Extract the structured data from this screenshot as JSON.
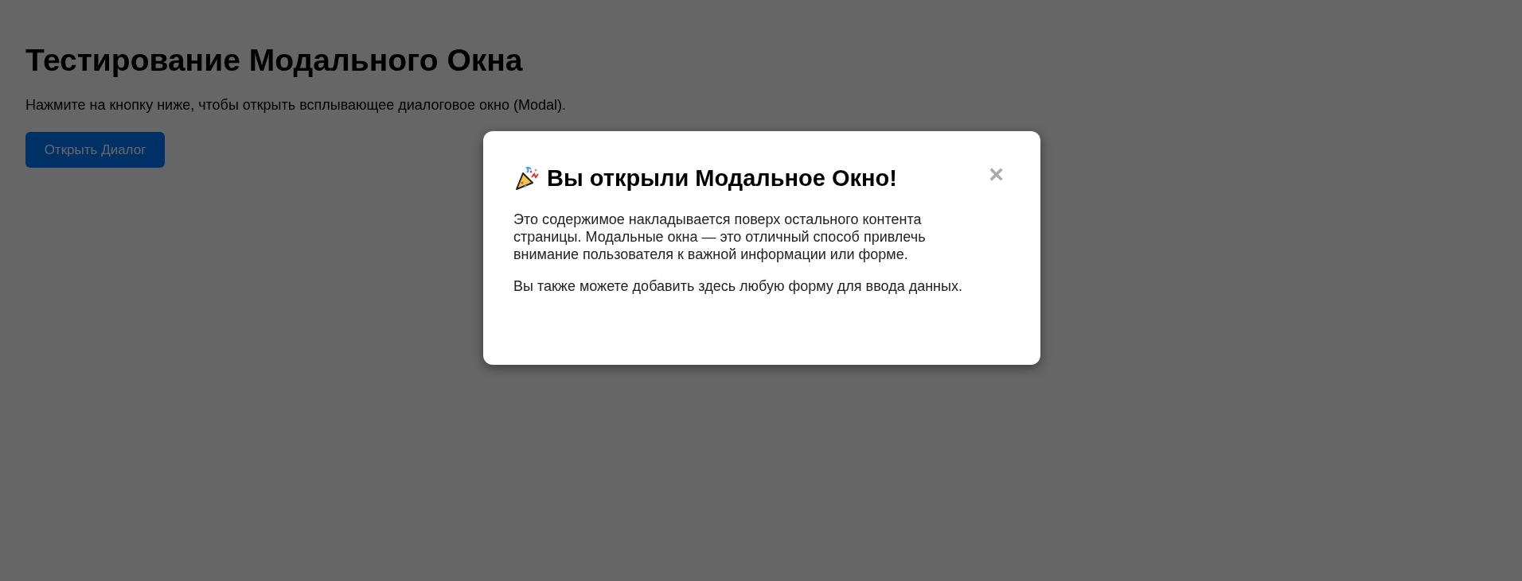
{
  "page": {
    "title": "Тестирование Модального Окна",
    "description": "Нажмите на кнопку ниже, чтобы открыть всплывающее диалоговое окно (Modal).",
    "button": "Открыть Диалог"
  },
  "modal": {
    "open": true,
    "title": "Вы открыли Модальное Окно!",
    "close": "×",
    "paragraphs": [
      "Это содержимое накладывается поверх остального контента страницы. Модальные окна — это отличный способ привлечь внимание пользователя к важной информации или форме.",
      "Вы также можете добавить здесь любую форму для ввода данных."
    ]
  }
}
